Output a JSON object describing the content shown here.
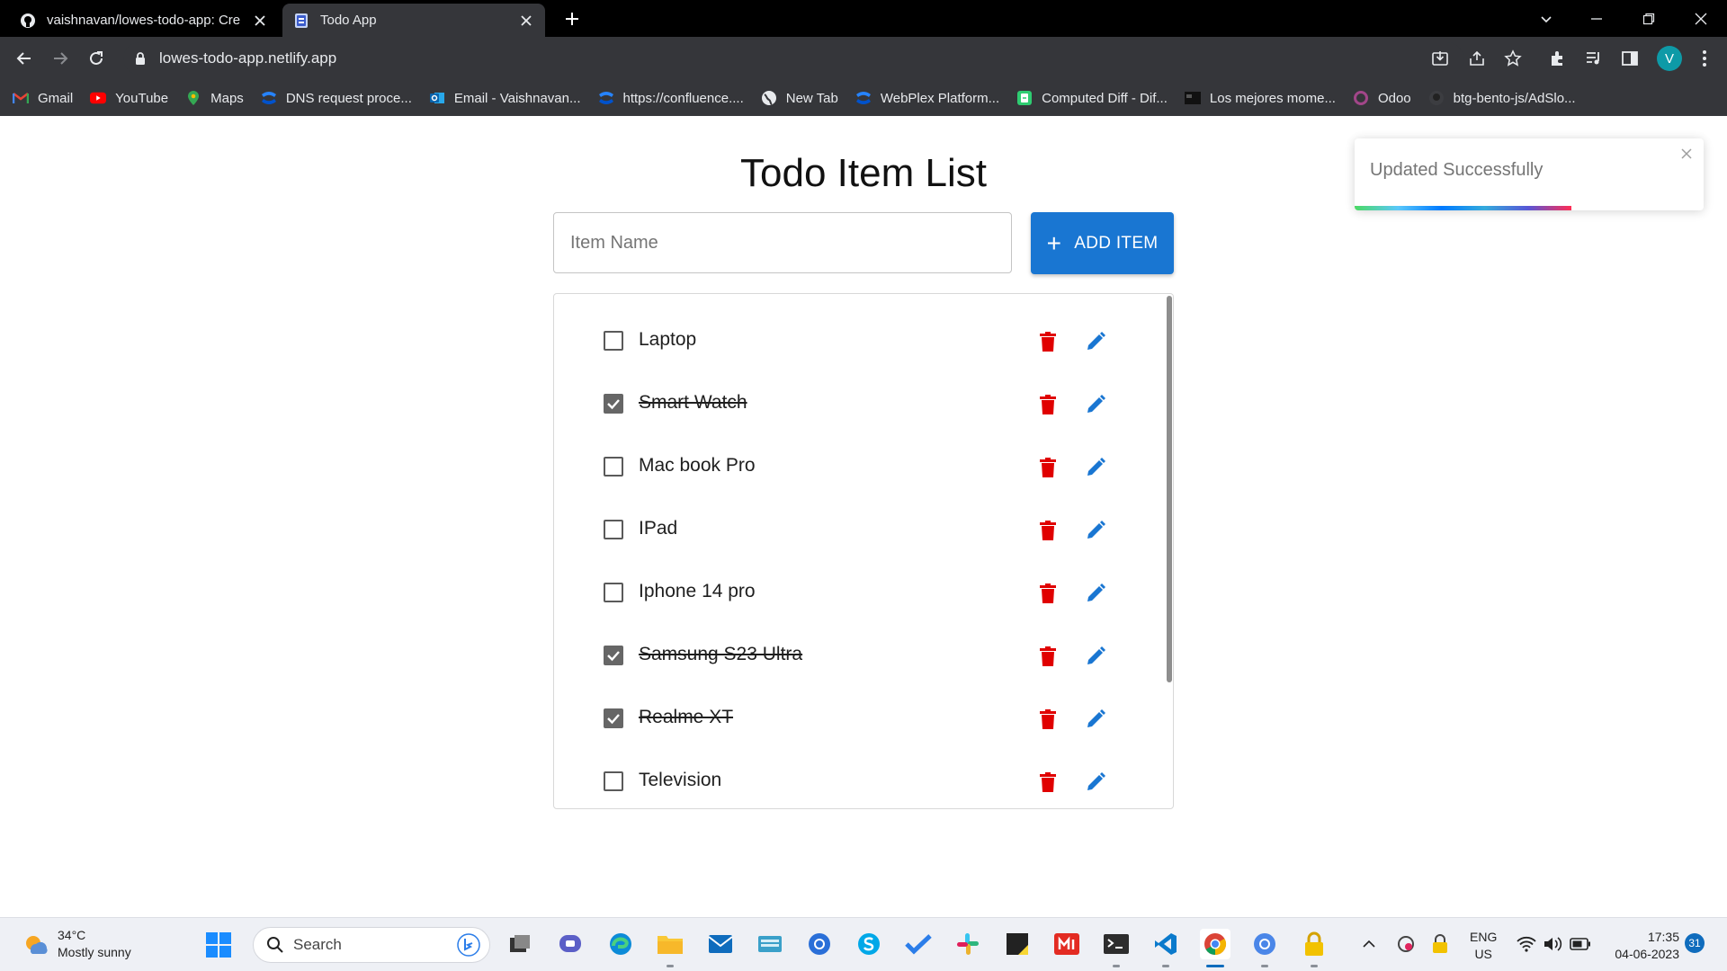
{
  "browser": {
    "tabs": [
      {
        "title": "vaishnavan/lowes-todo-app: Cre",
        "favicon": "github-icon",
        "active": false
      },
      {
        "title": "Todo App",
        "favicon": "document-icon",
        "active": true
      }
    ],
    "url": "lowes-todo-app.netlify.app",
    "profile_initial": "V",
    "bookmarks": [
      {
        "label": "Gmail",
        "icon": "gmail-icon"
      },
      {
        "label": "YouTube",
        "icon": "youtube-icon"
      },
      {
        "label": "Maps",
        "icon": "maps-icon"
      },
      {
        "label": "DNS request proce...",
        "icon": "confluence-icon"
      },
      {
        "label": "Email - Vaishnavan...",
        "icon": "outlook-icon"
      },
      {
        "label": "https://confluence....",
        "icon": "confluence-icon"
      },
      {
        "label": "New Tab",
        "icon": "globe-icon"
      },
      {
        "label": "WebPlex Platform...",
        "icon": "confluence-icon"
      },
      {
        "label": "Computed Diff - Dif...",
        "icon": "diff-icon"
      },
      {
        "label": "Los mejores mome...",
        "icon": "folder-dark-icon"
      },
      {
        "label": "Odoo",
        "icon": "odoo-icon"
      },
      {
        "label": "btg-bento-js/AdSlo...",
        "icon": "github-icon"
      }
    ]
  },
  "app": {
    "title": "Todo Item List",
    "input_placeholder": "Item Name",
    "add_button_label": "ADD ITEM",
    "items": [
      {
        "label": "Laptop",
        "done": false
      },
      {
        "label": "Smart Watch",
        "done": true
      },
      {
        "label": "Mac book Pro",
        "done": false
      },
      {
        "label": "IPad",
        "done": false
      },
      {
        "label": "Iphone 14 pro",
        "done": false
      },
      {
        "label": "Samsung S23 Ultra",
        "done": true
      },
      {
        "label": "Realme XT",
        "done": true
      },
      {
        "label": "Television",
        "done": false
      }
    ],
    "toast": {
      "message": "Updated Successfully",
      "progress": 0.62
    }
  },
  "colors": {
    "primary": "#1976d2",
    "delete": "#e00000",
    "edit": "#1976d2",
    "checked": "#666666"
  },
  "taskbar": {
    "weather_temp": "34°C",
    "weather_desc": "Mostly sunny",
    "search_placeholder": "Search",
    "lang_line1": "ENG",
    "lang_line2": "US",
    "time": "17:35",
    "date": "04-06-2023",
    "notification_count": "31"
  }
}
